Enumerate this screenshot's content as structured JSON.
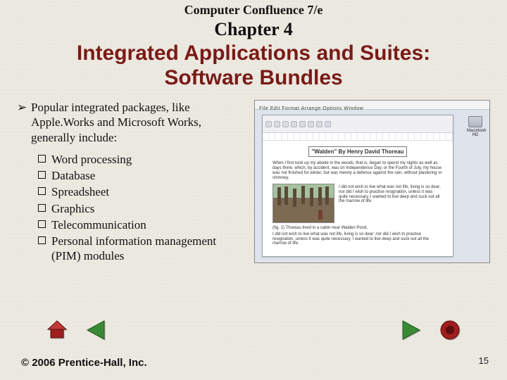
{
  "header": {
    "book_title": "Computer Confluence 7/e",
    "chapter_label": "Chapter 4",
    "section_title_line1": "Integrated Applications and Suites:",
    "section_title_line2": "Software Bundles"
  },
  "body": {
    "intro": "Popular integrated packages, like Apple.Works and Microsoft Works, generally include:",
    "items": [
      "Word processing",
      "Database",
      "Spreadsheet",
      "Graphics",
      "Telecommunication",
      "Personal information management (PIM) modules"
    ]
  },
  "screenshot": {
    "menubar_text": "File  Edit  Format  Arrange  Options  Window",
    "hd_label": "Macintosh HD",
    "doc_title": "\"Walden\" By Henry David Thoreau",
    "paragraph_top": "When I first took up my abode in the woods, that is, began to spend my nights as well as days there, which, by accident, was on Independence Day, or the Fourth of July, my house was not finished for winter, but was merely a defence against the rain, without plastering or chimney.",
    "caption": "(fig. 1) Thoreau lived in a cabin near Walden Pond.",
    "paragraph_bottom": "I did not wish to live what was not life, living is so dear; nor did I wish to practise resignation, unless it was quite necessary. I wanted to live deep and suck out all the marrow of life."
  },
  "nav": {
    "home": "home-icon",
    "prev": "prev-icon",
    "next": "next-icon",
    "last": "last-icon"
  },
  "footer": {
    "copyright": "© 2006 Prentice-Hall, Inc.",
    "page": "15"
  },
  "colors": {
    "accent": "#7a1a16",
    "nav_green": "#3a8a35",
    "nav_red": "#a01e1e"
  }
}
